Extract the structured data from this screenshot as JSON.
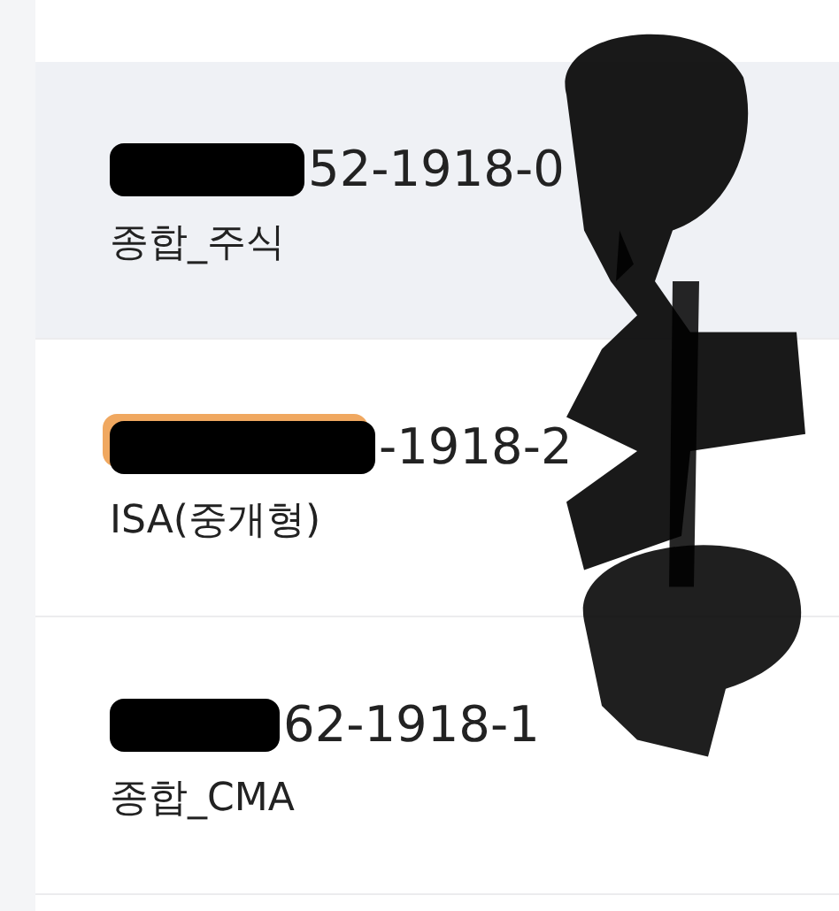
{
  "accounts": [
    {
      "number": "52-1918-0",
      "type": "종합_주식",
      "selected": true
    },
    {
      "number": "-1918-2",
      "type": "ISA(중개형)",
      "selected": false
    },
    {
      "number": "62-1918-1",
      "type": "종합_CMA",
      "selected": false
    }
  ]
}
